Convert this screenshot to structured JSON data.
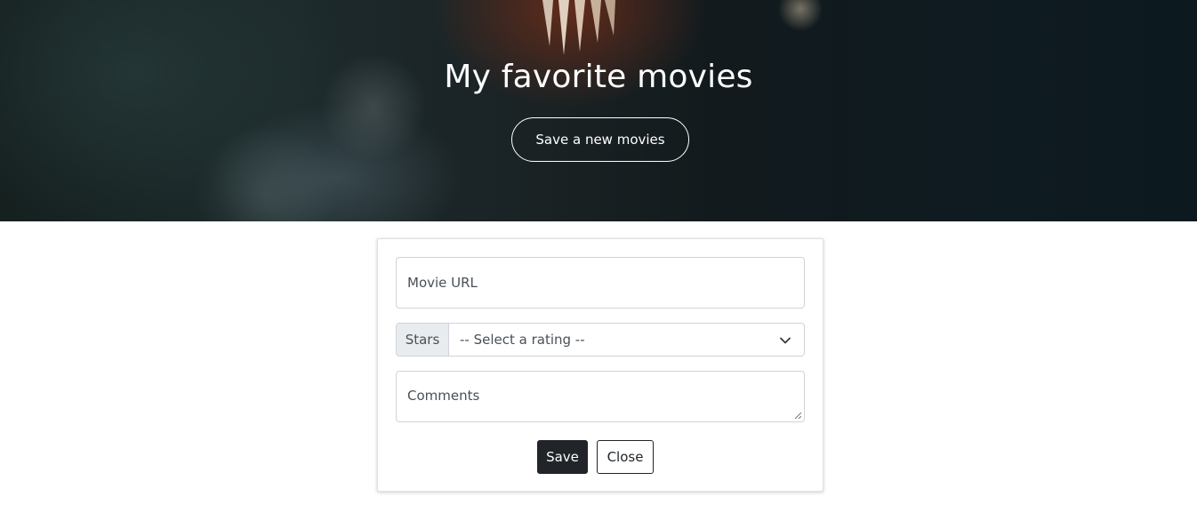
{
  "hero": {
    "title": "My favorite movies",
    "button_label": "Save a new movies"
  },
  "form": {
    "url_placeholder": "Movie URL",
    "stars_label": "Stars",
    "rating_selected": "-- Select a rating --",
    "comments_placeholder": "Comments",
    "save_label": "Save",
    "close_label": "Close"
  },
  "icons": {
    "select_chevron": "chevron-down-icon",
    "textarea_grip": "resize-grip-icon"
  },
  "colors": {
    "dark_button": "#212529",
    "addon_background": "#e9ecef",
    "border": "#ced4da"
  }
}
